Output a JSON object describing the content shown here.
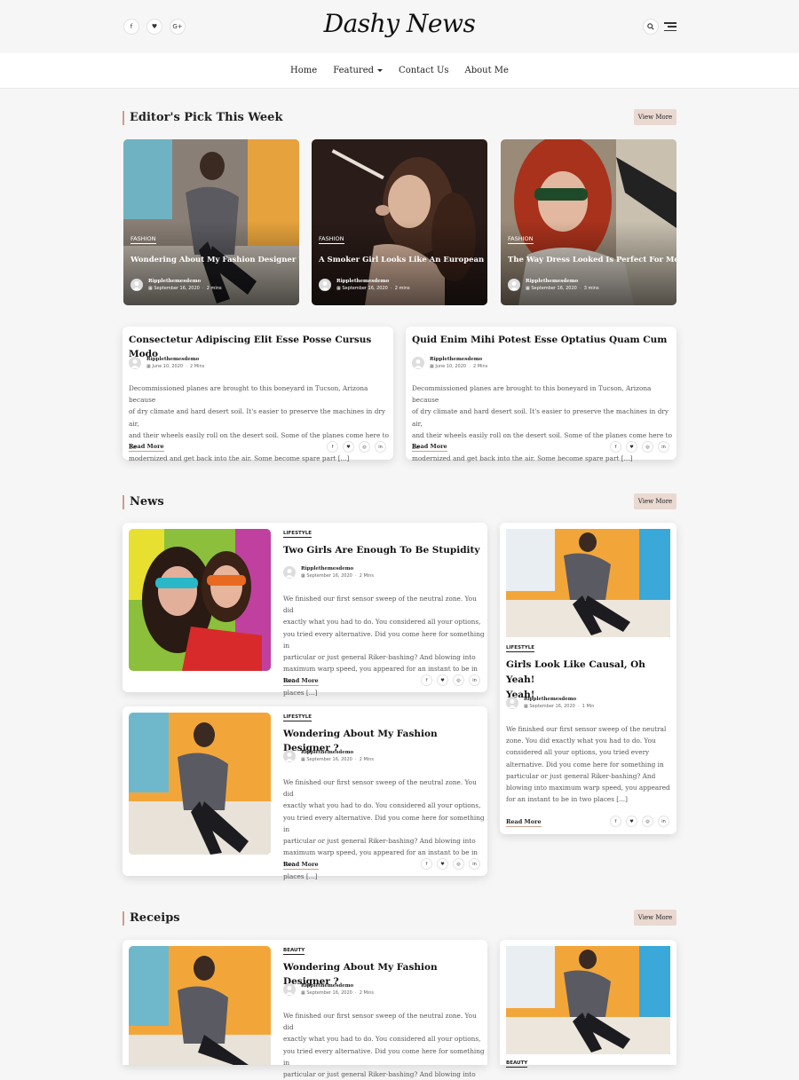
{
  "site": {
    "logo": "Dashy News"
  },
  "header": {
    "social": [
      "f",
      "♥",
      "G+"
    ],
    "nav": [
      "Home",
      "Featured",
      "Contact Us",
      "About Me"
    ]
  },
  "sections": {
    "editors_pick": {
      "title": "Editor's Pick This Week",
      "view_more": "View More"
    },
    "news": {
      "title": "News",
      "view_more": "View More"
    },
    "receips": {
      "title": "Receips",
      "view_more": "View More"
    }
  },
  "picks": [
    {
      "category": "FASHION",
      "title": "Wondering About My Fashion Designer ?",
      "author": "Ripplethemesdemo",
      "date": "September 16, 2020",
      "read": "2 mins"
    },
    {
      "category": "FASHION",
      "title": "A Smoker Girl Looks Like An European",
      "author": "Ripplethemesdemo",
      "date": "September 16, 2020",
      "read": "2 mins"
    },
    {
      "category": "FASHION",
      "title": "The Way Dress Looked Is Perfect For Me",
      "author": "Ripplethemesdemo",
      "date": "September 16, 2020",
      "read": "3 mins"
    }
  ],
  "text_posts": [
    {
      "title": "Consectetur Adipiscing Elit Esse Posse Cursus Modo",
      "author": "Ripplethemesdemo",
      "date": "June 10, 2020",
      "read": "2 Mins",
      "lines": [
        "Decommissioned planes are brought to this boneyard in Tucson, Arizona because",
        "of dry climate and hard desert soil. It's easier to preserve the machines in dry air,",
        "and their wheels easily roll on the desert soil. Some of the planes come here to be",
        "modernized and get back into the air. Some become spare part [...]"
      ],
      "read_more": "Read More"
    },
    {
      "title": "Quid Enim Mihi Potest Esse Optatius Quam Cum",
      "author": "Ripplethemesdemo",
      "date": "June 10, 2020",
      "read": "2 Mins",
      "lines": [
        "Decommissioned planes are brought to this boneyard in Tucson, Arizona because",
        "of dry climate and hard desert soil. It's easier to preserve the machines in dry air,",
        "and their wheels easily roll on the desert soil. Some of the planes come here to be",
        "modernized and get back into the air. Some become spare part [...]"
      ],
      "read_more": "Read More"
    }
  ],
  "news": [
    {
      "category": "LIFESTYLE",
      "title": "Two Girls Are Enough To Be Stupidity",
      "author": "Ripplethemesdemo",
      "date": "September 16, 2020",
      "read": "2 Mins",
      "lines": [
        "We finished our first sensor sweep of the neutral zone. You did",
        "exactly what you had to do. You considered all your options,",
        "you tried every alternative. Did you come here for something in",
        "particular or just general Riker-bashing? And blowing into",
        "maximum warp speed, you appeared for an instant to be in two",
        "places [...]"
      ],
      "read_more": "Read More"
    },
    {
      "category": "LIFESTYLE",
      "title": "Wondering About My Fashion Designer ?",
      "author": "Ripplethemesdemo",
      "date": "September 16, 2020",
      "read": "2 Mins",
      "lines": [
        "We finished our first sensor sweep of the neutral zone. You did",
        "exactly what you had to do. You considered all your options,",
        "you tried every alternative. Did you come here for something in",
        "particular or just general Riker-bashing? And blowing into",
        "maximum warp speed, you appeared for an instant to be in two",
        "places [...]"
      ],
      "read_more": "Read More"
    },
    {
      "category": "LIFESTYLE",
      "title_1": "Girls Look Like Causal, Oh Yeah!",
      "title_2": "Yeah!",
      "author": "Ripplethemesdemo",
      "date": "September 16, 2020",
      "read": "1 Min",
      "lines": [
        "We finished our first sensor sweep of the neutral",
        "zone. You did exactly what you had to do. You",
        "considered all your options, you tried every",
        "alternative. Did you come here for something in",
        "particular or just general Riker-bashing? And",
        "blowing into maximum warp speed, you appeared",
        "for an instant to be in two places [...]"
      ],
      "read_more": "Read More"
    }
  ],
  "receips": [
    {
      "category": "BEAUTY",
      "title": "Wondering About My Fashion Designer ?",
      "author": "Ripplethemesdemo",
      "date": "September 16, 2020",
      "read": "2 Mins",
      "lines": [
        "We finished our first sensor sweep of the neutral zone. You did",
        "exactly what you had to do. You considered all your options,",
        "you tried every alternative. Did you come here for something in",
        "particular or just general Riker-bashing? And blowing into"
      ]
    },
    {
      "category": "BEAUTY"
    }
  ],
  "share_icons": [
    "f",
    "♥",
    "◎",
    "in"
  ]
}
